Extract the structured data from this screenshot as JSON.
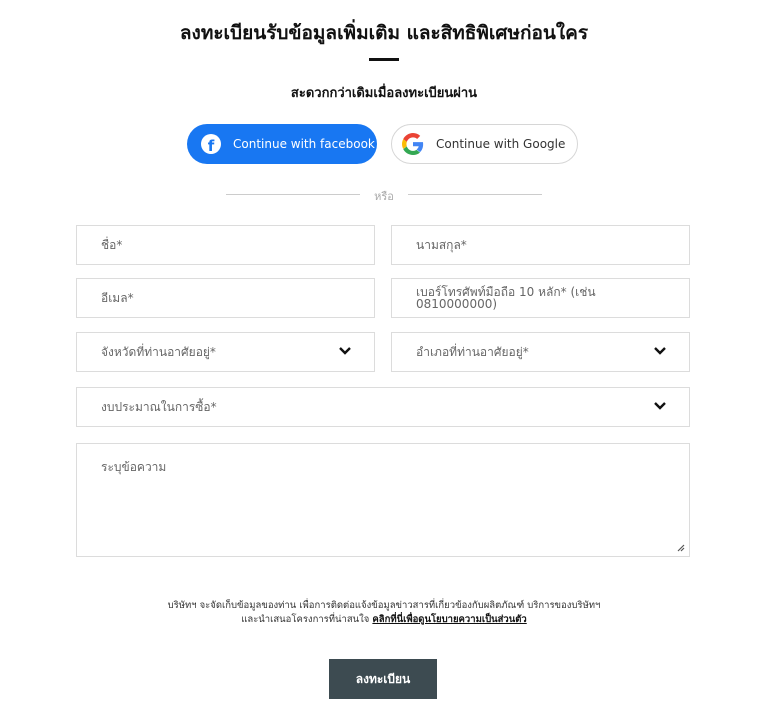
{
  "header": {
    "title": "ลงทะเบียนรับข้อมูลเพิ่มเติม และสิทธิพิเศษก่อนใคร",
    "subtitle": "สะดวกกว่าเดิมเมื่อลงทะเบียนผ่าน"
  },
  "social": {
    "facebook_label": "Continue with facebook",
    "google_label": "Continue with Google",
    "divider_text": "หรือ",
    "facebook_color": "#1877f2"
  },
  "form": {
    "first_name_placeholder": "ชื่อ*",
    "last_name_placeholder": "นามสกุล*",
    "email_placeholder": "อีเมล*",
    "phone_placeholder": "เบอร์โทรศัพท์มือถือ 10 หลัก* (เช่น 0810000000)",
    "province_placeholder": "จังหวัดที่ท่านอาศัยอยู่*",
    "district_placeholder": "อำเภอที่ท่านอาศัยอยู่*",
    "budget_placeholder": "งบประมาณในการซื้อ*",
    "message_placeholder": "ระบุข้อความ"
  },
  "consent": {
    "line1": "บริษัทฯ จะจัดเก็บข้อมูลของท่าน เพื่อการติดต่อแจ้งข้อมูลข่าวสารที่เกี่ยวข้องกับผลิตภัณฑ์ บริการของบริษัทฯ",
    "line2": "และนำเสนอโครงการที่น่าสนใจ",
    "link": "คลิกที่นี่เพื่อดูนโยบายความเป็นส่วนตัว"
  },
  "submit": {
    "label": "ลงทะเบียน",
    "color": "#3d4b51"
  }
}
